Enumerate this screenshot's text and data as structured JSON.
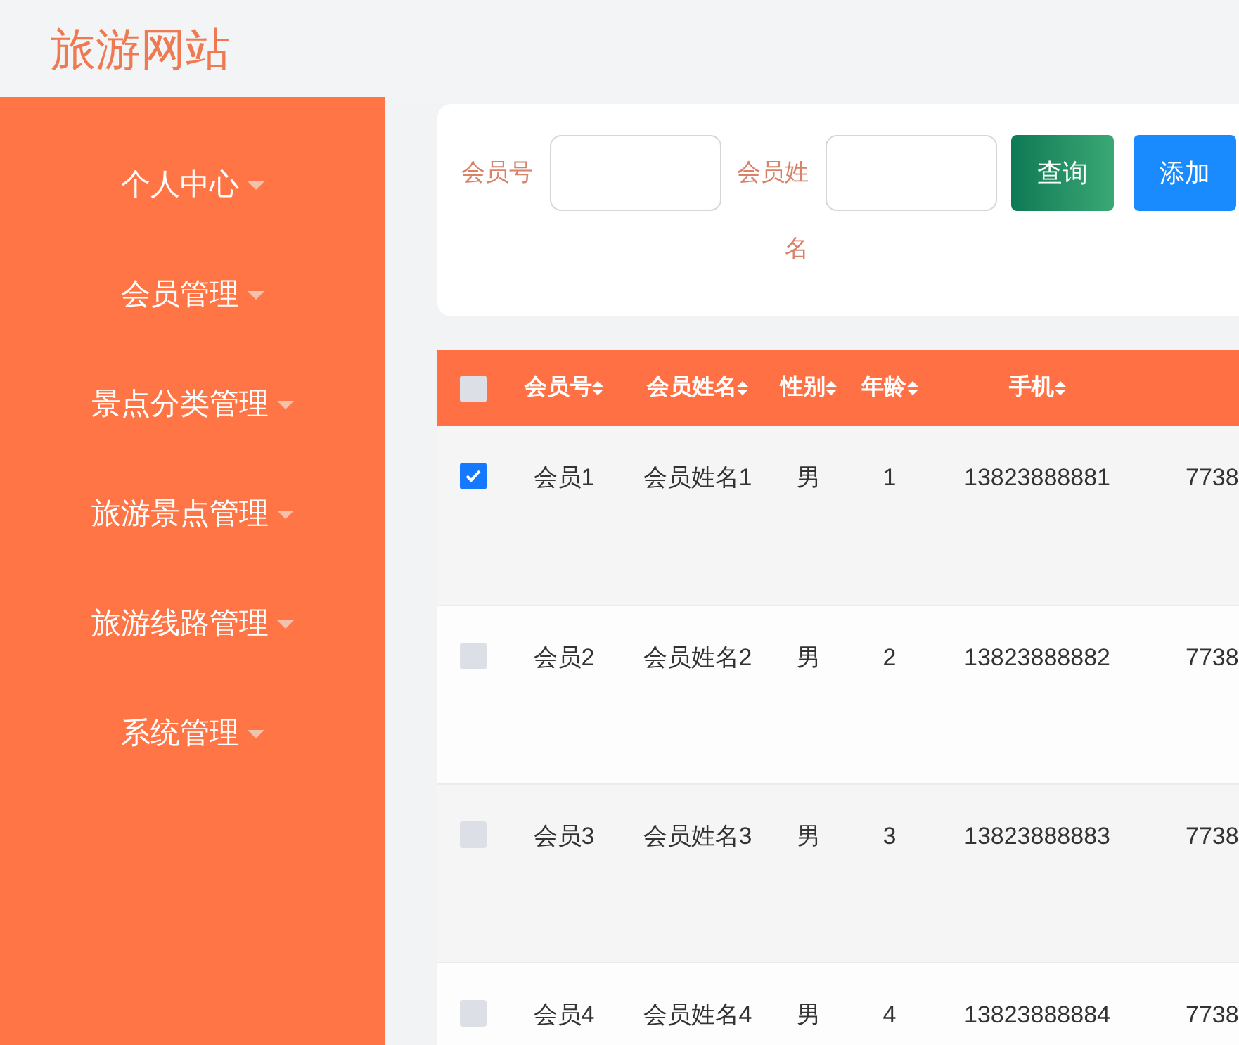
{
  "site_title": "旅游网站",
  "sidebar": {
    "items": [
      {
        "label": "个人中心",
        "expanded": false
      },
      {
        "label": "会员管理",
        "expanded": false
      },
      {
        "label": "景点分类管理",
        "expanded": false
      },
      {
        "label": "旅游景点管理",
        "expanded": false
      },
      {
        "label": "旅游线路管理",
        "expanded": false
      },
      {
        "label": "系统管理",
        "expanded": false
      }
    ]
  },
  "search": {
    "fields": [
      {
        "label": "会员号"
      },
      {
        "label": "会员姓名"
      }
    ],
    "buttons": [
      {
        "label": "查询",
        "kind": "query"
      },
      {
        "label": "添加",
        "kind": "add"
      }
    ]
  },
  "table": {
    "all_checked": false,
    "columns": [
      "会员号",
      "会员姓名",
      "性别",
      "年龄",
      "手机"
    ],
    "rows": [
      {
        "checked": true,
        "cells": [
          "会员1",
          "会员姓名1",
          "男",
          "1",
          "13823888881",
          "7738"
        ]
      },
      {
        "checked": false,
        "cells": [
          "会员2",
          "会员姓名2",
          "男",
          "2",
          "13823888882",
          "7738"
        ]
      },
      {
        "checked": false,
        "cells": [
          "会员3",
          "会员姓名3",
          "男",
          "3",
          "13823888883",
          "7738"
        ]
      },
      {
        "checked": false,
        "cells": [
          "会员4",
          "会员姓名4",
          "男",
          "4",
          "13823888884",
          "7738"
        ]
      }
    ]
  }
}
